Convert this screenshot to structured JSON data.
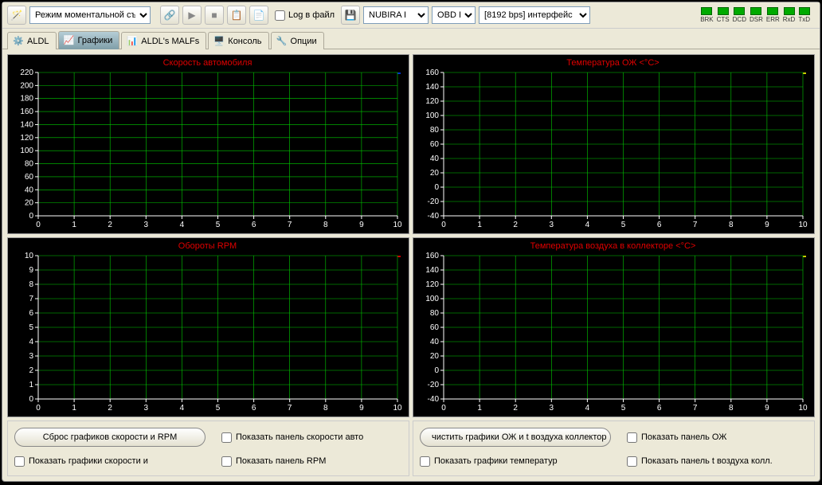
{
  "toolbar": {
    "mode_selected": "Режим моментальной съем",
    "log_label": "Log в файл",
    "car_selected": "NUBIRA I",
    "obd_selected": "OBD I",
    "iface_selected": "[8192 bps] интерфейс",
    "leds": [
      "BRK",
      "CTS",
      "DCD",
      "DSR",
      "ERR",
      "RxD",
      "TxD"
    ]
  },
  "tabs": {
    "aldl": "ALDL",
    "graphs": "Графики",
    "malfs": "ALDL's MALFs",
    "console": "Консоль",
    "options": "Опции"
  },
  "charts": {
    "speed": {
      "title": "Скорость автомобиля",
      "color": "#e00000",
      "legend": "#0033cc"
    },
    "coolant": {
      "title": "Температура ОЖ  <°C>",
      "color": "#e00000",
      "legend": "#cccc00"
    },
    "rpm": {
      "title": "Обороты RPM",
      "color": "#e00000",
      "legend": "#cc0000"
    },
    "airtemp": {
      "title": "Температура воздуха в коллекторе <°C>",
      "color": "#e00000",
      "legend": "#cccc00"
    }
  },
  "chart_data": [
    {
      "id": "speed",
      "type": "line",
      "title": "Скорость автомобиля",
      "x": [
        0,
        1,
        2,
        3,
        4,
        5,
        6,
        7,
        8,
        9,
        10
      ],
      "yticks": [
        0,
        20,
        40,
        60,
        80,
        100,
        120,
        140,
        160,
        180,
        200,
        220
      ],
      "xlim": [
        0,
        10
      ],
      "ylim": [
        0,
        220
      ],
      "series": [
        {
          "name": "speed",
          "values": []
        }
      ]
    },
    {
      "id": "coolant",
      "type": "line",
      "title": "Температура ОЖ <°C>",
      "x": [
        0,
        1,
        2,
        3,
        4,
        5,
        6,
        7,
        8,
        9,
        10
      ],
      "yticks": [
        -40,
        -20,
        0,
        20,
        40,
        60,
        80,
        100,
        120,
        140,
        160
      ],
      "xlim": [
        0,
        10
      ],
      "ylim": [
        -40,
        160
      ],
      "series": [
        {
          "name": "coolant",
          "values": []
        }
      ]
    },
    {
      "id": "rpm",
      "type": "line",
      "title": "Обороты RPM",
      "x": [
        0,
        1,
        2,
        3,
        4,
        5,
        6,
        7,
        8,
        9,
        10
      ],
      "yticks": [
        0.0,
        1.0,
        2.0,
        3.0,
        4.0,
        5.0,
        6.0,
        7.0,
        8.0,
        9.0,
        10.0
      ],
      "xlim": [
        0,
        10
      ],
      "ylim": [
        0,
        10
      ],
      "series": [
        {
          "name": "rpm",
          "values": []
        }
      ]
    },
    {
      "id": "airtemp",
      "type": "line",
      "title": "Температура воздуха в коллекторе <°C>",
      "x": [
        0,
        1,
        2,
        3,
        4,
        5,
        6,
        7,
        8,
        9,
        10
      ],
      "yticks": [
        -40,
        -20,
        0,
        20,
        40,
        60,
        80,
        100,
        120,
        140,
        160
      ],
      "xlim": [
        0,
        10
      ],
      "ylim": [
        -40,
        160
      ],
      "series": [
        {
          "name": "airtemp",
          "values": []
        }
      ]
    }
  ],
  "left_controls": {
    "reset_btn": "Сброс графиков скорости и RPM",
    "show_speed_panel": "Показать панель скорости авто",
    "show_speed_graphs": "Показать графики скорости и",
    "show_rpm_panel": "Показать панель RPM"
  },
  "right_controls": {
    "clear_btn": "чистить графики ОЖ и t воздуха коллектор",
    "show_coolant_panel": "Показать панель ОЖ",
    "show_temp_graphs": "Показать графики температур",
    "show_air_panel": "Показать панель t воздуха колл."
  }
}
